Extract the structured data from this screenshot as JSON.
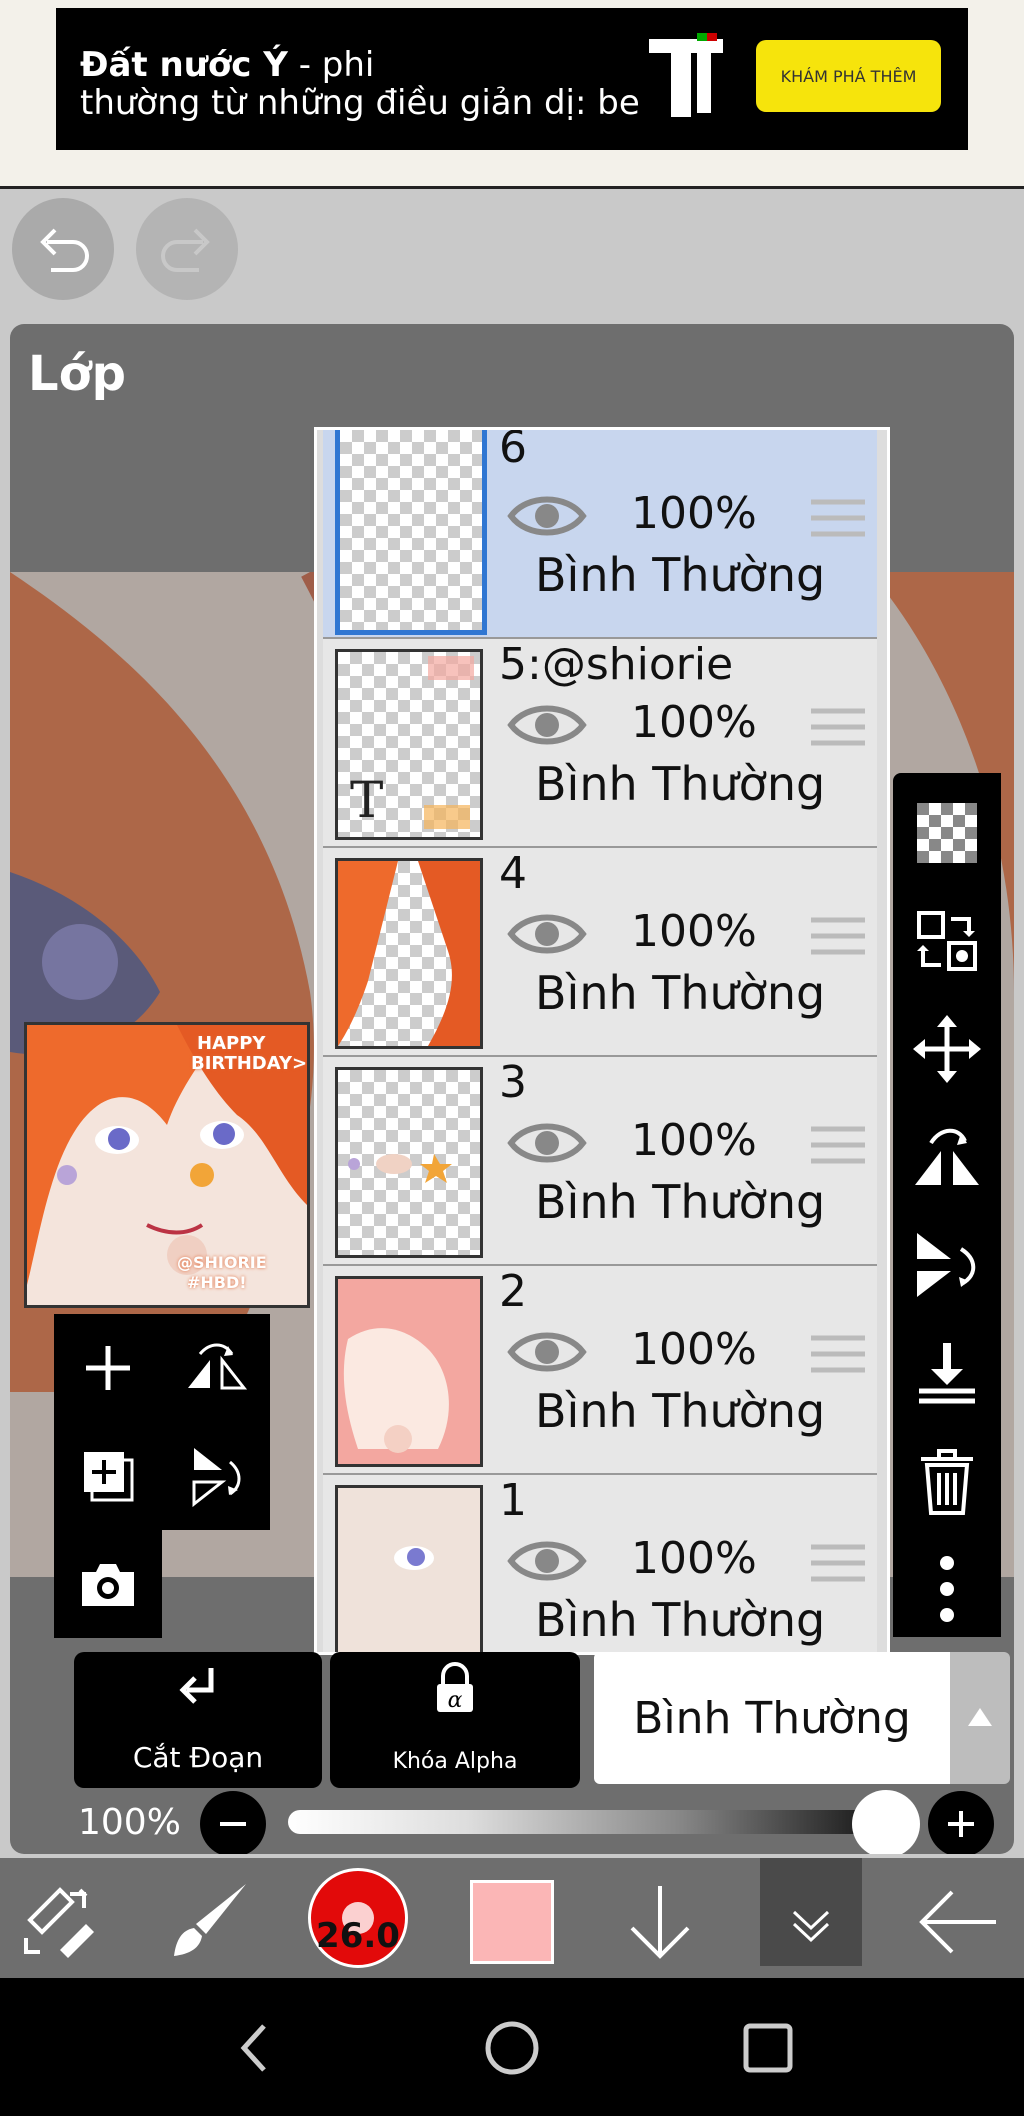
{
  "ad": {
    "headline_bold": "Đất nước Ý",
    "headline_rest": " - phi\nthường từ những điều giản dị: be",
    "cta": "KHÁM PHÁ THÊM"
  },
  "dialog": {
    "title": "Lớp"
  },
  "thumbnail": {
    "line1": "HAPPY",
    "line2": "BIRTHDAY>",
    "line3": "@SHIORIE",
    "line4": "#HBD!"
  },
  "layers": [
    {
      "name": "6",
      "opacity": "100%",
      "blend": "Bình Thường",
      "selected": true
    },
    {
      "name": "5:@shiorie",
      "opacity": "100%",
      "blend": "Bình Thường",
      "selected": false,
      "text_layer_icon": "T"
    },
    {
      "name": "4",
      "opacity": "100%",
      "blend": "Bình Thường",
      "selected": false
    },
    {
      "name": "3",
      "opacity": "100%",
      "blend": "Bình Thường",
      "selected": false
    },
    {
      "name": "2",
      "opacity": "100%",
      "blend": "Bình Thường",
      "selected": false
    },
    {
      "name": "1",
      "opacity": "100%",
      "blend": "Bình Thường",
      "selected": false
    }
  ],
  "actions": {
    "clipping": "Cắt Đoạn",
    "alpha_lock": "Khóa Alpha",
    "blend_mode": "Bình Thường"
  },
  "opacity": {
    "label": "100%",
    "value": 1.0
  },
  "brush": {
    "size": "26.0",
    "color": "#fbb6b6"
  },
  "colors": {
    "selected_layer_bg": "#c8d6ee",
    "selection_border": "#2f76d2",
    "ad_cta": "#f6e40c"
  }
}
